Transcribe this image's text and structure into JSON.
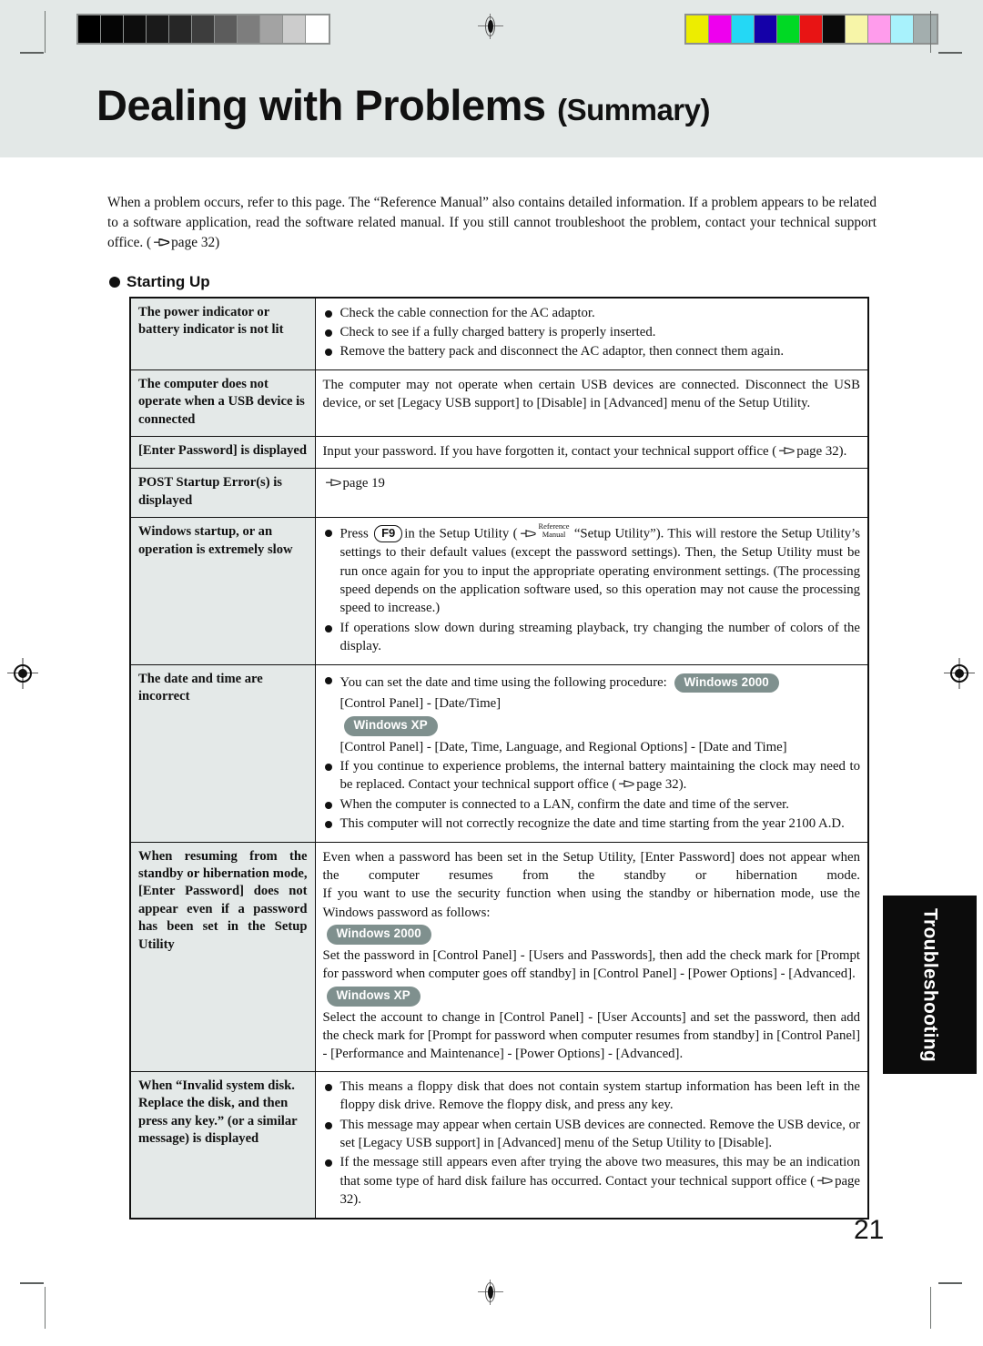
{
  "document": {
    "title_main": "Dealing with Problems",
    "title_sub": "(Summary)",
    "page_number": "21",
    "side_tab": "Troubleshooting",
    "intro": "When a problem occurs, refer to this page.  The “Reference Manual” also contains detailed information.  If a problem appears to be related to a software application, read the software related manual.  If you still cannot troubleshoot the problem, contact your technical support office. (",
    "intro_ref": "page 32)",
    "section_title": "Starting Up"
  },
  "calibration": {
    "grayscale_swatches": [
      "#000000",
      "#050505",
      "#0d0d0d",
      "#1a1a1a",
      "#262626",
      "#3d3d3d",
      "#5c5c5c",
      "#7d7d7d",
      "#a3a3a3",
      "#cccccc",
      "#ffffff"
    ],
    "color_swatches": [
      "#eded00",
      "#ee00ee",
      "#24d8f5",
      "#1400a8",
      "#00d924",
      "#e81414",
      "#0a0a0a",
      "#f7f5a8",
      "#ff9cec",
      "#a8f2fc",
      "#a3aeae"
    ]
  },
  "labels": {
    "reference_manual_line1": "Reference",
    "reference_manual_line2": "Manual",
    "key_f9": "F9",
    "badge_win2000": "Windows 2000",
    "badge_winxp": "Windows XP"
  },
  "table": {
    "rows": [
      {
        "symptom": "The power indicator or battery indicator is not lit",
        "symptom_hyphenated": "The power indicator or bat-tery indicator is not lit",
        "remedy_type": "bullets",
        "bullets": [
          "Check the cable connection for the AC adaptor.",
          "Check to see if a fully charged battery is properly inserted.",
          "Remove the battery pack and disconnect the AC adaptor, then connect them again."
        ]
      },
      {
        "symptom": "The computer does not operate when a USB device is connected",
        "remedy_type": "text",
        "text": "The computer may not operate when certain USB devices are connected.  Disconnect the USB device, or set [Legacy USB support] to [Disable] in [Advanced] menu of the Setup Utility."
      },
      {
        "symptom": "[Enter Password] is displayed",
        "remedy_type": "text_with_ref",
        "text_before": "Input your password.  If you have forgotten it, contact your technical support office (",
        "ref_text": "page 32).",
        "text_after": ""
      },
      {
        "symptom": "POST Startup Error(s) is displayed",
        "remedy_type": "ref_only",
        "ref_text": "page 19"
      },
      {
        "symptom": "Windows startup, or an operation is extremely slow",
        "remedy_type": "f9_bullets",
        "bullet1_a": "Press",
        "bullet1_b": "in the Setup Utility (",
        "bullet1_c": "“Setup Utility”).  This will restore the Setup Utility’s settings to their default values (except the password settings).  Then, the Setup Utility must be run once again for you to input the appropriate operating environment settings.  (The processing speed depends on the application software used, so this operation may not cause the processing speed to increase.)",
        "bullet2": "If operations slow down during streaming playback, try changing the number of colors of the display."
      },
      {
        "symptom": "The date and time are incorrect",
        "remedy_type": "date_time",
        "lead": "You can set the date and time using the following procedure:",
        "win2000_path": "[Control Panel] - [Date/Time]",
        "winxp_path": "[Control Panel] - [Date, Time, Language, and Regional Options] - [Date and Time]",
        "bullet2_before": "If you continue to experience problems, the internal battery maintaining the clock may need to be replaced.  Contact your technical support office (",
        "bullet2_ref": "page 32).",
        "bullet3": "When the computer is connected to a LAN, confirm the date and time of the server.",
        "bullet4": "This computer will not correctly recognize the date and time starting from the year 2100 A.D."
      },
      {
        "symptom": "When resuming from the standby or hibernation mode, [Enter Password] does not appear even if a password has been set in the Setup Utility",
        "remedy_type": "resume_password",
        "para1": "Even when a password has been set in the Setup Utility, [Enter Password] does not appear when the computer resumes from the standby or hibernation mode.",
        "para2": "If you want to use the security function when using the standby or hibernation mode, use the Windows password as follows:",
        "win2000_text": "Set the password in [Control Panel] - [Users and Passwords], then add the check mark for [Prompt for password when computer goes off standby] in [Control Panel] - [Power Options] - [Advanced].",
        "winxp_text": "Select the account to change in [Control Panel] - [User Accounts] and set the password, then add the check mark for [Prompt for password when computer resumes from standby] in [Control Panel] - [Performance and Maintenance] - [Power Options] - [Advanced]."
      },
      {
        "symptom": "When “Invalid system disk.  Replace the disk, and then press any key.” (or a similar message) is displayed",
        "remedy_type": "invalid_disk",
        "bullet1": "This means a floppy disk that does not contain system startup information has been left in the floppy disk drive.  Remove the floppy disk, and press any key.",
        "bullet2": "This message may appear when certain USB devices are connected.  Remove the USB device, or set [Legacy USB support] in [Advanced] menu of the Setup Utility to [Disable].",
        "bullet3_before": "If the message still appears even after trying the above two measures, this may be an indication that some type of hard disk failure has occurred.  Contact your technical support office (",
        "bullet3_ref": "page 32)."
      }
    ]
  }
}
